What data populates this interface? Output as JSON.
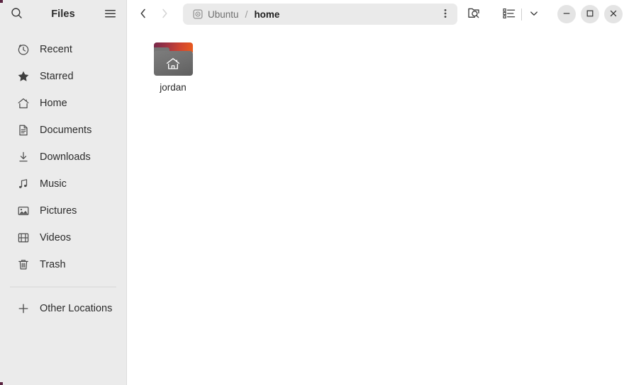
{
  "window": {
    "app_title": "Files",
    "accent_color": "#e95420",
    "sidebar_bg": "#ebebeb",
    "content_bg": "#ffffff"
  },
  "header": {
    "search_icon": "search-icon",
    "menu_icon": "hamburger-menu-icon",
    "back_icon": "chevron-left-icon",
    "forward_icon": "chevron-right-icon",
    "back_tooltip": "Back",
    "forward_tooltip": "Forward",
    "pathbar_menu_icon": "vertical-dots-icon",
    "search_folder_icon": "folder-search-icon",
    "view_list_icon": "list-view-icon",
    "view_dropdown_icon": "chevron-down-icon",
    "minimize_icon": "minimize-icon",
    "maximize_icon": "maximize-icon",
    "close_icon": "close-icon",
    "minimize_label": "–",
    "maximize_label": "□",
    "close_label": "×"
  },
  "breadcrumb": {
    "root": {
      "label": "Ubuntu",
      "icon": "disk-icon"
    },
    "separator": "/",
    "current": "home"
  },
  "sidebar": {
    "items": [
      {
        "label": "Recent",
        "icon": "clock-icon"
      },
      {
        "label": "Starred",
        "icon": "star-icon"
      },
      {
        "label": "Home",
        "icon": "home-icon"
      },
      {
        "label": "Documents",
        "icon": "document-icon"
      },
      {
        "label": "Downloads",
        "icon": "download-arrow-icon"
      },
      {
        "label": "Music",
        "icon": "music-note-icon"
      },
      {
        "label": "Pictures",
        "icon": "image-icon"
      },
      {
        "label": "Videos",
        "icon": "film-icon"
      },
      {
        "label": "Trash",
        "icon": "trash-icon"
      }
    ],
    "other_locations": {
      "label": "Other Locations",
      "icon": "plus-icon"
    }
  },
  "files": {
    "items": [
      {
        "name": "jordan",
        "type": "home-folder",
        "icon": "folder-home-icon"
      }
    ]
  }
}
